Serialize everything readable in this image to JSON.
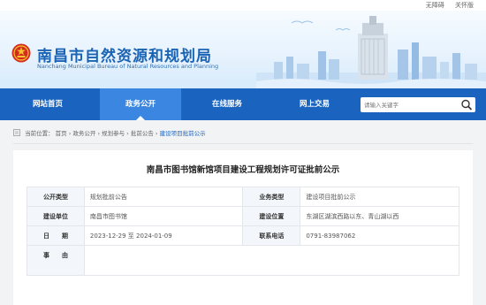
{
  "topbar": {
    "accessibility": "无障碍",
    "care_mode": "关怀版"
  },
  "header": {
    "title": "南昌市自然资源和规划局",
    "subtitle": "Nanchang Municipal Bureau of Natural Resources and Planning"
  },
  "nav": {
    "items": [
      {
        "label": "网站首页"
      },
      {
        "label": "政务公开"
      },
      {
        "label": "在线服务"
      },
      {
        "label": "网上交易"
      }
    ],
    "search_placeholder": "请输入关键字"
  },
  "breadcrumb": {
    "prefix": "当前位置：",
    "path": "首页 › 政务公开 › 规划参与 › 批前公告 › ",
    "current": "建设项目批前公示"
  },
  "document": {
    "title": "南昌市图书馆新馆项目建设工程规划许可证批前公示",
    "rows": [
      {
        "k1": "公开类型",
        "v1": "规划批前公告",
        "k2": "业务类型",
        "v2": "建设项目批前公示"
      },
      {
        "k1": "建设单位",
        "v1": "南昌市图书馆",
        "k2": "建设位置",
        "v2": "东湖区湖滨西路以东、青山湖以西"
      },
      {
        "k1": "日　　期",
        "v1": "2023-12-29 至 2024-01-09",
        "k2": "联系电话",
        "v2": "0791-83987062"
      },
      {
        "k1": "事　　由",
        "v1": ""
      }
    ]
  },
  "colors": {
    "brand": "#1a64c0",
    "nav_active": "#3a86e0",
    "title": "#1a63b5"
  }
}
